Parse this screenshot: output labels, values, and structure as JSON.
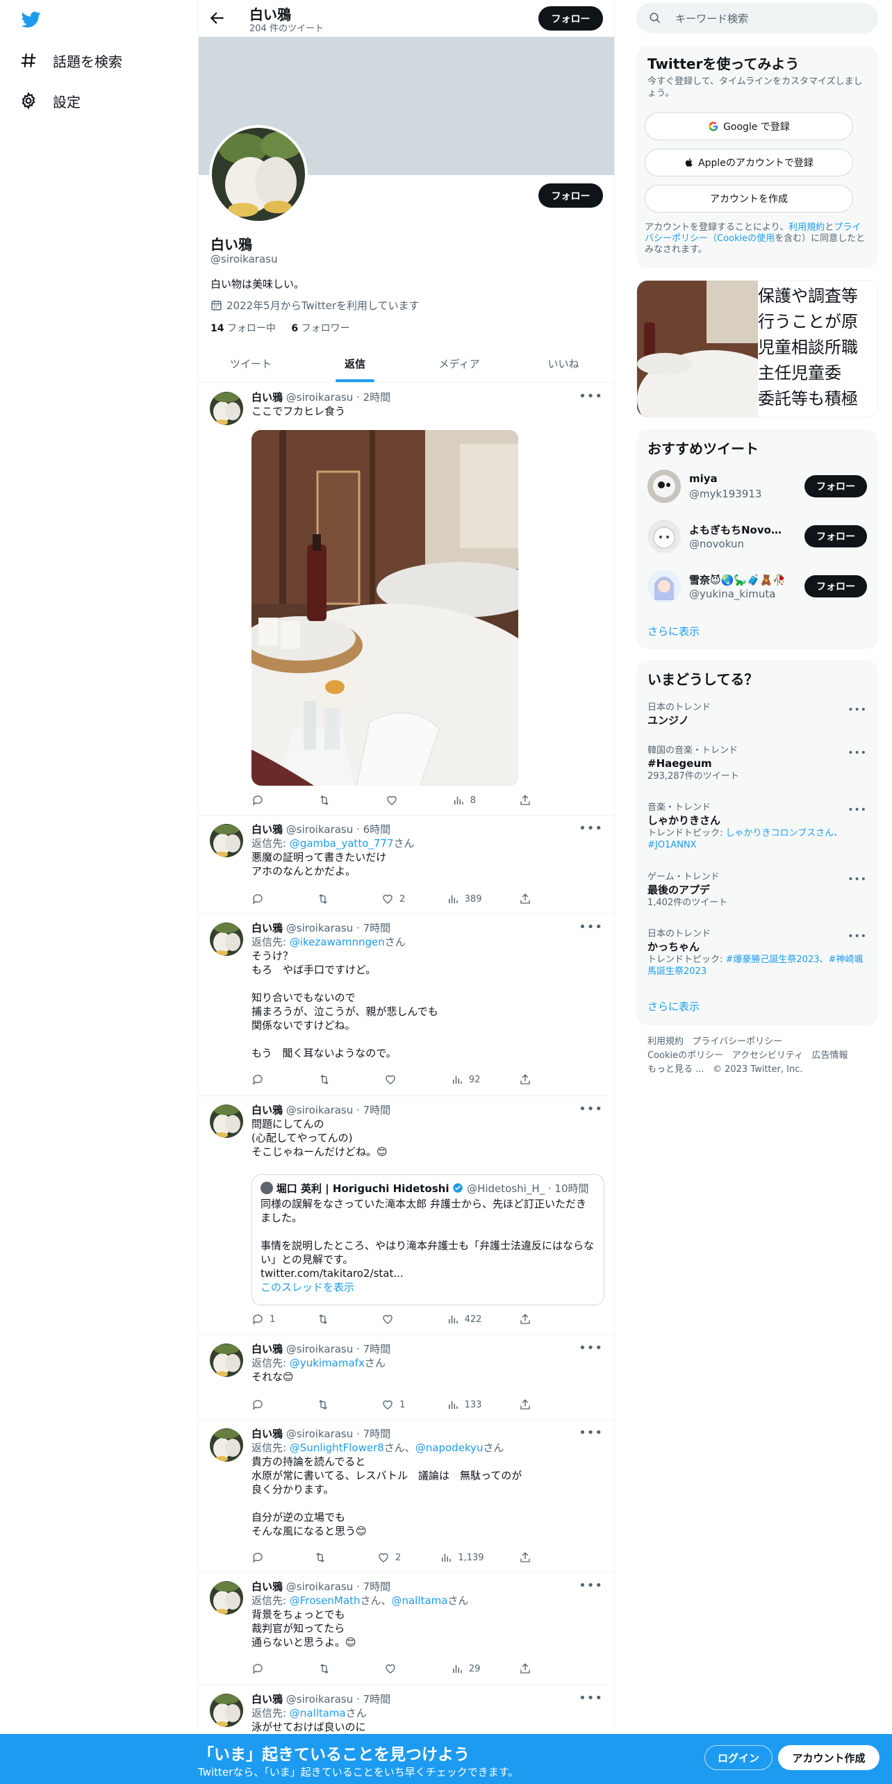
{
  "nav": {
    "items": [
      {
        "label": "話題を検索",
        "icon": "hashtag-icon"
      },
      {
        "label": "設定",
        "icon": "gear-icon"
      }
    ]
  },
  "header": {
    "name": "白い鴉",
    "tweet_count": "204 件のツイート",
    "follow_label": "フォロー"
  },
  "profile": {
    "name": "白い鴉",
    "handle": "@siroikarasu",
    "bio": "白い物は美味しい。",
    "joined": "2022年5月からTwitterを利用しています",
    "following_count": "14",
    "following_label": "フォロー中",
    "followers_count": "6",
    "followers_label": "フォロワー",
    "follow_label": "フォロー"
  },
  "tabs": [
    {
      "label": "ツイート"
    },
    {
      "label": "返信"
    },
    {
      "label": "メディア"
    },
    {
      "label": "いいね"
    }
  ],
  "tweets": [
    {
      "name": "白い鴉",
      "handle": "@siroikarasu",
      "time": "2時間",
      "reply_prefix": "",
      "reply_to": "",
      "reply_to2": "",
      "reply_suffix": "",
      "text": "ここでフカヒレ食う",
      "stats": {
        "reply": "",
        "retweet": "",
        "like": "",
        "views": "8"
      }
    },
    {
      "name": "白い鴉",
      "handle": "@siroikarasu",
      "time": "6時間",
      "reply_prefix": "返信先: ",
      "reply_to": "@gamba_yatto_777",
      "reply_to2": "",
      "reply_suffix": "さん",
      "text": "悪魔の証明って書きたいだけ\nアホのなんとかだよ。",
      "stats": {
        "reply": "",
        "retweet": "",
        "like": "2",
        "views": "389"
      }
    },
    {
      "name": "白い鴉",
      "handle": "@siroikarasu",
      "time": "7時間",
      "reply_prefix": "返信先: ",
      "reply_to": "@ikezawamnngen",
      "reply_to2": "",
      "reply_suffix": "さん",
      "text": "そうけ？\nもろ　やば手口ですけど。\n\n知り合いでもないので\n捕まろうが、泣こうが、親が悲しんでも\n関係ないですけどね。\n\nもう　聞く耳ないようなので。",
      "stats": {
        "reply": "",
        "retweet": "",
        "like": "",
        "views": "92"
      }
    },
    {
      "name": "白い鴉",
      "handle": "@siroikarasu",
      "time": "7時間",
      "reply_prefix": "",
      "reply_to": "",
      "reply_to2": "",
      "reply_suffix": "",
      "text": "問題にしてんの\n(心配してやってんの)\nそこじゃねーんだけどね。😊",
      "stats": {
        "reply": "1",
        "retweet": "",
        "like": "",
        "views": "422"
      }
    },
    {
      "name": "白い鴉",
      "handle": "@siroikarasu",
      "time": "7時間",
      "reply_prefix": "返信先: ",
      "reply_to": "@yukimamafx",
      "reply_to2": "",
      "reply_suffix": "さん",
      "text": "それな😊",
      "stats": {
        "reply": "",
        "retweet": "",
        "like": "1",
        "views": "133"
      }
    },
    {
      "name": "白い鴉",
      "handle": "@siroikarasu",
      "time": "7時間",
      "reply_prefix": "返信先: ",
      "reply_to": "@SunlightFlower8",
      "reply_mid": "さん、",
      "reply_to2": "@napodekyu",
      "reply_suffix": "さん",
      "text": "貴方の持論を読んでると\n水原が常に書いてる、レスバトル　議論は　無駄ってのが\n良く分かります。\n\n自分が逆の立場でも\nそんな風になると思う😊",
      "stats": {
        "reply": "",
        "retweet": "",
        "like": "2",
        "views": "1,139"
      }
    },
    {
      "name": "白い鴉",
      "handle": "@siroikarasu",
      "time": "7時間",
      "reply_prefix": "返信先: ",
      "reply_to": "@FrosenMath",
      "reply_mid": "さん、",
      "reply_to2": "@nalltama",
      "reply_suffix": "さん",
      "text": "背景をちょっとでも\n裁判官が知ってたら\n通らないと思うよ。😊",
      "stats": {
        "reply": "",
        "retweet": "",
        "like": "",
        "views": "29"
      }
    },
    {
      "name": "白い鴉",
      "handle": "@siroikarasu",
      "time": "7時間",
      "reply_prefix": "返信先: ",
      "reply_to": "@nalltama",
      "reply_to2": "",
      "reply_suffix": "さん",
      "text": "泳がせておけば良いのに",
      "stats": {
        "reply": "",
        "retweet": "",
        "like": "",
        "views": ""
      }
    }
  ],
  "quote": {
    "name": "堀口 英利 | Horiguchi Hidetoshi",
    "handle": "@Hidetoshi_H_",
    "time": "10時間",
    "text": "同様の誤解をなさっていた滝本太郎 弁護士から、先ほど訂正いただきました。\n\n事情を説明したところ、やはり滝本弁護士も「弁護士法違反にはならない」との見解です。\ntwitter.com/takitaro2/stat...",
    "thread_link": "このスレッドを表示"
  },
  "right": {
    "search_placeholder": "キーワード検索",
    "signup": {
      "title": "Twitterを使ってみよう",
      "desc": "今すぐ登録して、タイムラインをカスタマイズしましょう。",
      "google": "Google で登録",
      "apple": "Appleのアカウントで登録",
      "create": "アカウントを作成",
      "terms_1": "アカウントを登録することにより、",
      "terms_link1": "利用規約",
      "terms_2": "と",
      "terms_link2": "プライバシーポリシー（Cookieの使用",
      "terms_3": "を含む）に同意したとみなされます。"
    },
    "media_text_lines": [
      "保護や調査等",
      "行うことが原",
      "児童相談所職",
      "主任児童委",
      "委託等も積極"
    ],
    "recommended": {
      "title": "おすすめツイート",
      "users": [
        {
          "name": "miya",
          "handle": "@myk193913",
          "follow": "フォロー"
        },
        {
          "name": "よもぎもちNovo🍡...",
          "handle": "@novokun",
          "follow": "フォロー"
        },
        {
          "name": "雪奈😈🌏🦕🧳🧸🥀",
          "handle": "@yukina_kimuta",
          "follow": "フォロー"
        }
      ],
      "more": "さらに表示"
    },
    "trends": {
      "title": "いまどうしてる？",
      "items": [
        {
          "category": "日本のトレンド",
          "name": "ユンジノ",
          "meta": "",
          "topic_prefix": "",
          "topic": ""
        },
        {
          "category": "韓国の音楽・トレンド",
          "name": "#Haegeum",
          "meta": "293,287件のツイート",
          "topic_prefix": "",
          "topic": ""
        },
        {
          "category": "音楽・トレンド",
          "name": "しゃかりきさん",
          "meta": "",
          "topic_prefix": "トレンドトピック: ",
          "topic": "しゃかりきコロンブスさん、#JO1ANNX"
        },
        {
          "category": "ゲーム・トレンド",
          "name": "最後のアプデ",
          "meta": "1,402件のツイート",
          "topic_prefix": "",
          "topic": ""
        },
        {
          "category": "日本のトレンド",
          "name": "かっちゃん",
          "meta": "",
          "topic_prefix": "トレンドトピック: ",
          "topic": "#爆豪勝己誕生祭2023、#神崎颯馬誕生祭2023"
        }
      ],
      "more": "さらに表示"
    },
    "footer": {
      "l1": "利用規約",
      "l2": "プライバシーポリシー",
      "l3": "Cookieのポリシー",
      "l4": "アクセシビリティ",
      "l5": "広告情報",
      "l6": "もっと見る ...",
      "copyright": "© 2023 Twitter, Inc."
    }
  },
  "bottom": {
    "title": "「いま」起きていることを見つけよう",
    "subtitle": "Twitterなら、「いま」起きていることをいち早くチェックできます。",
    "login": "ログイン",
    "signup": "アカウント作成"
  },
  "colors": {
    "accent": "#1d9bf0",
    "text": "#0f1419",
    "secondary": "#536471",
    "banner": "#cfd9de"
  }
}
